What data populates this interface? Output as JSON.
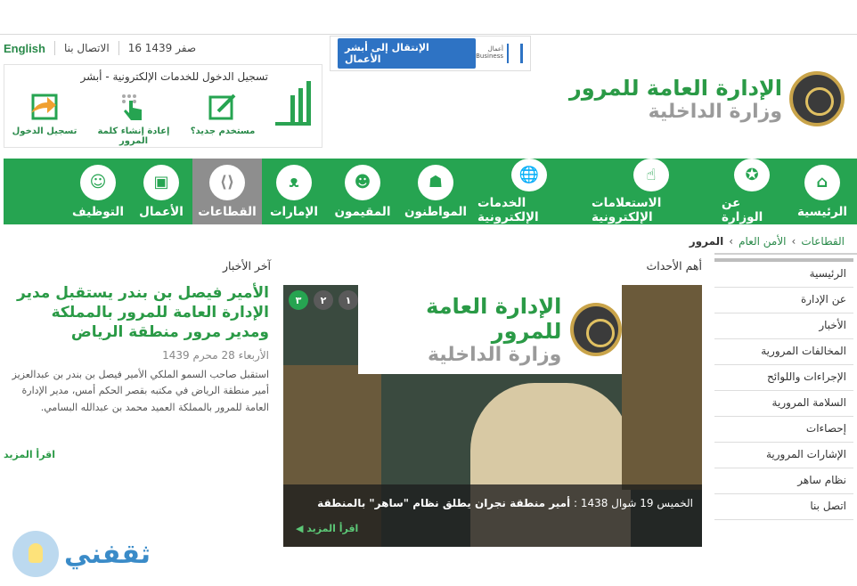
{
  "util": {
    "english": "English",
    "contact": "الاتصال بنا",
    "date": "16 صفر 1439"
  },
  "business": {
    "button": "الإنتقال إلى أبشر الأعمال",
    "logo_ar": "أعمال",
    "logo_en": "Business"
  },
  "absher": {
    "title": "تسجيل الدخول للخدمات الإلكترونية - أبشر",
    "options": [
      "مستخدم جديد؟",
      "إعادة إنشاء كلمة المرور",
      "تسجيل الدخول"
    ]
  },
  "brand": {
    "line1": "الإدارة العامة للمرور",
    "line2": "وزارة الداخلية"
  },
  "nav": [
    {
      "label": "الرئيسية",
      "icon": "home-icon",
      "glyph": "⌂"
    },
    {
      "label": "عن الوزارة",
      "icon": "emblem-icon",
      "glyph": "✪"
    },
    {
      "label": "الاستعلامات الإلكترونية",
      "icon": "pointer-icon",
      "glyph": "☝"
    },
    {
      "label": "الخدمات الإلكترونية",
      "icon": "globe-icon",
      "glyph": "🌐"
    },
    {
      "label": "المواطنون",
      "icon": "citizen-icon",
      "glyph": "☗"
    },
    {
      "label": "المقيمون",
      "icon": "residents-icon",
      "glyph": "☻"
    },
    {
      "label": "الإمارات",
      "icon": "emirates-icon",
      "glyph": "ᴥ"
    },
    {
      "label": "القطاعات",
      "icon": "share-icon",
      "glyph": "⟨⟩",
      "active": true
    },
    {
      "label": "الأعمال",
      "icon": "briefcase-icon",
      "glyph": "▣"
    },
    {
      "label": "التوظيف",
      "icon": "people-icon",
      "glyph": "☺"
    }
  ],
  "breadcrumb": {
    "items": [
      "القطاعات",
      "الأمن العام",
      "المرور"
    ]
  },
  "sidebar": {
    "items": [
      "الرئيسية",
      "عن الإدارة",
      "الأخبار",
      "المخالفات المرورية",
      "الإجراءات واللوائح",
      "السلامة المرورية",
      "إحصاءات",
      "الإشارات المرورية",
      "نظام ساهر",
      "اتصل بنا"
    ]
  },
  "events": {
    "title": "أهم الأحداث",
    "slides": [
      "٣",
      "٢",
      "١"
    ],
    "overlay1": "الإدارة العامة للمرور",
    "overlay2": "وزارة الداخلية",
    "caption_date": "الخميس 19 شوال 1438 :",
    "caption_text": "أمير منطقة نجران يطلق نظام \"ساهر\" بالمنطقة",
    "more": "◀ اقرأ المزيد"
  },
  "news": {
    "title": "آخر الأخبار",
    "headline": "الأمير فيصل بن بندر يستقبل مدير الإدارة العامة للمرور بالمملكة ومدير مرور منطقة الرياض",
    "date": "الأربعاء 28 محرم 1439",
    "body": "استقبل صاحب السمو الملكي الأمير فيصل بن بندر بن عبدالعزيز أمير منطقة الرياض في مكتبه بقصر الحكم أمس، مدير الإدارة العامة للمرور بالمملكة العميد محمد بن عبدالله البسامي.",
    "more": "اقرأ المزيد"
  },
  "watermark": "ثقفني"
}
